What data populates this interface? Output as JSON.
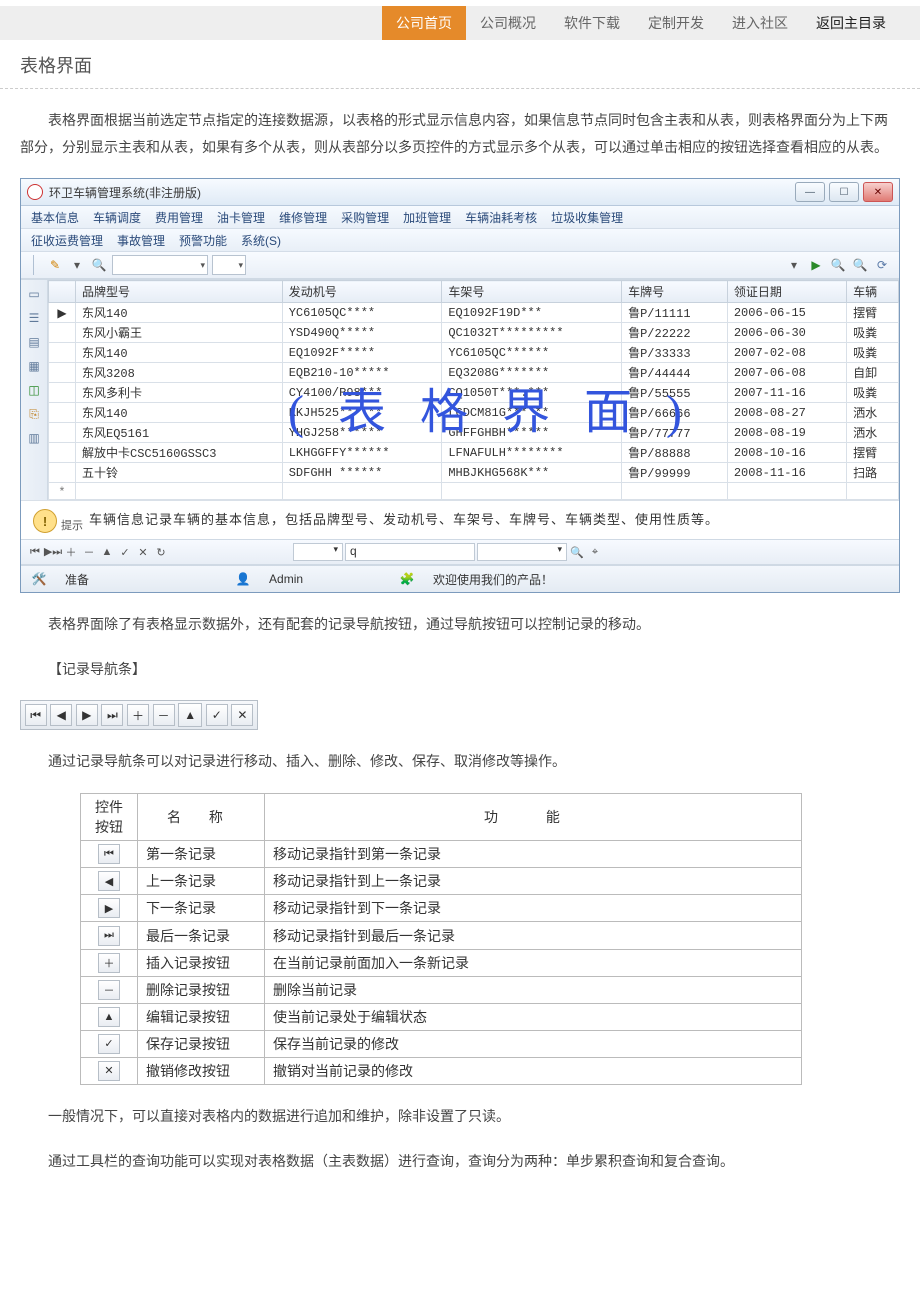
{
  "topnav": {
    "items": [
      "公司首页",
      "公司概况",
      "软件下载",
      "定制开发",
      "进入社区"
    ],
    "return": "返回主目录",
    "active_index": 0
  },
  "page_title": "表格界面",
  "intro_paragraph": "表格界面根据当前选定节点指定的连接数据源，以表格的形式显示信息内容，如果信息节点同时包含主表和从表，则表格界面分为上下两部分，分别显示主表和从表，如果有多个从表，则从表部分以多页控件的方式显示多个从表，可以通过单击相应的按钮选择查看相应的从表。",
  "app": {
    "title": "环卫车辆管理系统(非注册版)",
    "menu_row1": [
      "基本信息",
      "车辆调度",
      "费用管理",
      "油卡管理",
      "维修管理",
      "采购管理",
      "加班管理",
      "车辆油耗考核",
      "垃圾收集管理"
    ],
    "menu_row2": [
      "征收运费管理",
      "事故管理",
      "预警功能",
      "系统(S)"
    ],
    "columns": [
      "品牌型号",
      "发动机号",
      "车架号",
      "车牌号",
      "领证日期",
      "车辆"
    ],
    "rows": [
      {
        "mark": "▶",
        "c": [
          "东风140",
          "YC6105QC****",
          "EQ1092F19D***",
          "鲁P/11111",
          "2006-06-15",
          "摆臂"
        ]
      },
      {
        "mark": "",
        "c": [
          "东风小霸王",
          "YSD490Q*****",
          "QC1032T*********",
          "鲁P/22222",
          "2006-06-30",
          "吸粪"
        ]
      },
      {
        "mark": "",
        "c": [
          "东风140",
          "EQ1092F*****",
          "YC6105QC******",
          "鲁P/33333",
          "2007-02-08",
          "吸粪"
        ]
      },
      {
        "mark": "",
        "c": [
          "东风3208",
          "EQB210-10*****",
          "EQ3208G*******",
          "鲁P/44444",
          "2007-06-08",
          "自卸"
        ]
      },
      {
        "mark": "",
        "c": [
          "东风多利卡",
          "CY4100/R98***",
          "CQ1050T***.***",
          "鲁P/55555",
          "2007-11-16",
          "吸粪"
        ]
      },
      {
        "mark": "",
        "c": [
          "东风140",
          "KKJH525******",
          "LGDCM81G*** **",
          "鲁P/66666",
          "2008-08-27",
          "洒水"
        ]
      },
      {
        "mark": "",
        "c": [
          "东风EQ5161",
          "YHGJ258******",
          "GHFFGHBH******",
          "鲁P/77777",
          "2008-08-19",
          "洒水"
        ]
      },
      {
        "mark": "",
        "c": [
          "解放中卡CSC5160GSSC3",
          "LKHGGFFY******",
          "LFNAFULH********",
          "鲁P/88888",
          "2008-10-16",
          "摆臂"
        ]
      },
      {
        "mark": "",
        "c": [
          "五十铃",
          "SDFGHH ******",
          "MHBJKHG568K***",
          "鲁P/99999",
          "2008-11-16",
          "扫路"
        ]
      }
    ],
    "hint_label": "提示",
    "hint_text": "车辆信息记录车辆的基本信息，包括品牌型号、发动机号、车架号、车牌号、车辆类型、使用性质等。",
    "nav_query_value": "q",
    "status": {
      "ready": "准备",
      "user": "Admin",
      "welcome": "欢迎使用我们的产品！"
    },
    "overlay_text": "(表格界面)"
  },
  "after_ss_paragraph": "表格界面除了有表格显示数据外，还有配套的记录导航按钮，通过导航按钮可以控制记录的移动。",
  "nav_section_title": "【记录导航条】",
  "nav_ops_paragraph": "通过记录导航条可以对记录进行移动、插入、删除、修改、保存、取消修改等操作。",
  "ftable": {
    "headers": {
      "control": "控件按钮",
      "name": "名 称",
      "func": "功   能"
    },
    "rows": [
      {
        "icon": "first",
        "name": "第一条记录",
        "func": "移动记录指针到第一条记录"
      },
      {
        "icon": "prev",
        "name": "上一条记录",
        "func": "移动记录指针到上一条记录"
      },
      {
        "icon": "next",
        "name": "下一条记录",
        "func": "移动记录指针到下一条记录"
      },
      {
        "icon": "last",
        "name": "最后一条记录",
        "func": "移动记录指针到最后一条记录"
      },
      {
        "icon": "insert",
        "name": "插入记录按钮",
        "func": "在当前记录前面加入一条新记录"
      },
      {
        "icon": "delete",
        "name": "删除记录按钮",
        "func": "删除当前记录"
      },
      {
        "icon": "edit",
        "name": "编辑记录按钮",
        "func": "使当前记录处于编辑状态"
      },
      {
        "icon": "save",
        "name": "保存记录按钮",
        "func": "保存当前记录的修改"
      },
      {
        "icon": "cancel",
        "name": "撤销修改按钮",
        "func": "撤销对当前记录的修改"
      }
    ]
  },
  "footer_p1": "一般情况下，可以直接对表格内的数据进行追加和维护，除非设置了只读。",
  "footer_p2": "通过工具栏的查询功能可以实现对表格数据（主表数据）进行查询，查询分为两种：单步累积查询和复合查询。"
}
